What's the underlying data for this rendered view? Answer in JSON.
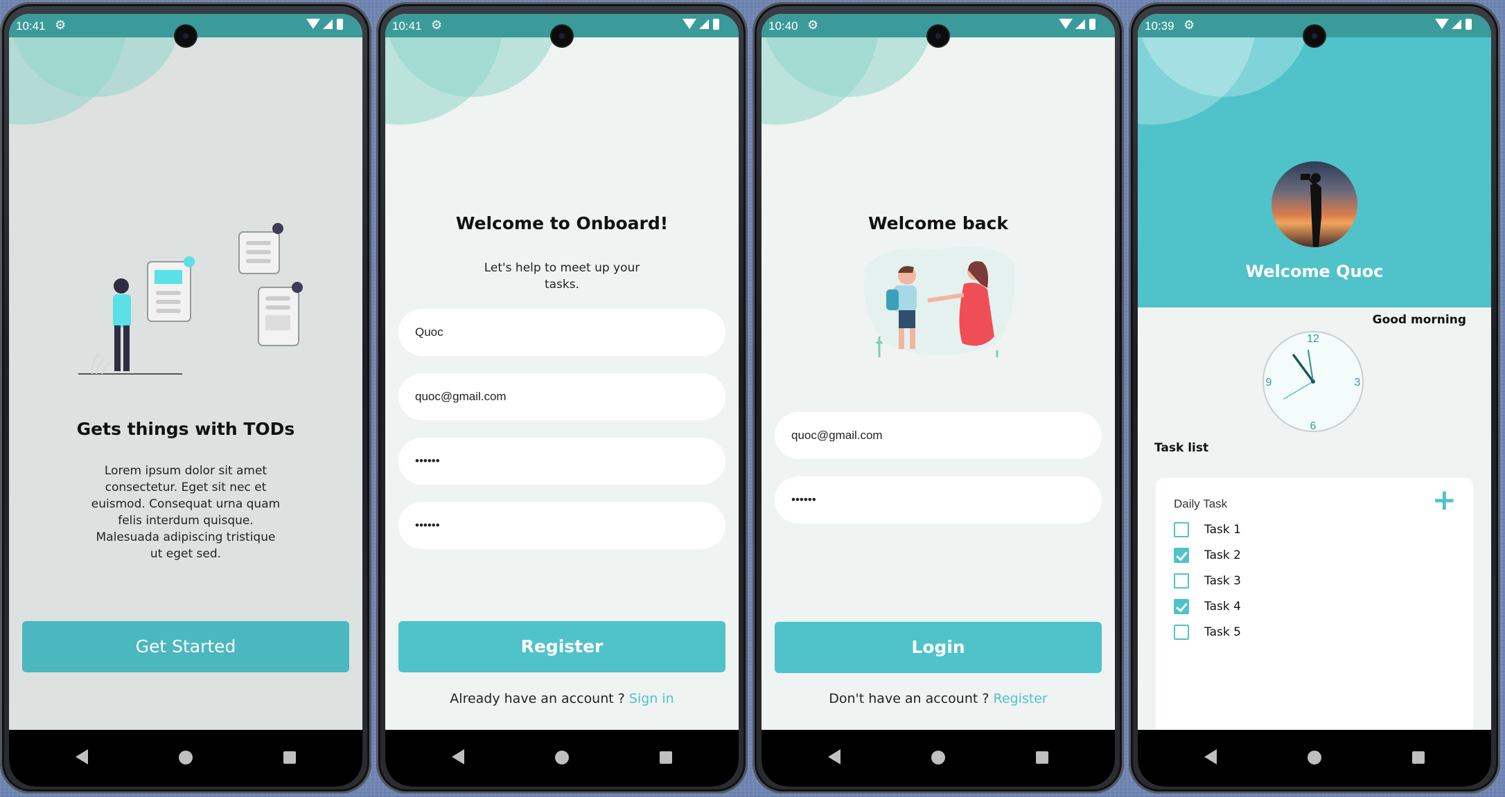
{
  "status": {
    "screen1_time": "10:41",
    "screen2_time": "10:41",
    "screen3_time": "10:40",
    "screen4_time": "10:39"
  },
  "screen1": {
    "title": "Gets things with TODs",
    "body": "Lorem ipsum dolor sit amet consectetur. Eget sit nec et euismod. Consequat urna quam felis interdum quisque. Malesuada adipiscing tristique ut eget sed.",
    "button": "Get Started"
  },
  "screen2": {
    "title": "Welcome to Onboard!",
    "subtitle": "Let's help to meet up your tasks.",
    "name_value": "Quoc",
    "email_value": "quoc@gmail.com",
    "password_value": "••••••",
    "confirm_value": "••••••",
    "button": "Register",
    "footer_text": "Already have an account ? ",
    "footer_link": "Sign in"
  },
  "screen3": {
    "title": "Welcome back",
    "email_value": "quoc@gmail.com",
    "password_value": "••••••",
    "button": "Login",
    "footer_text": "Don't have an account ? ",
    "footer_link": "Register"
  },
  "screen4": {
    "welcome": "Welcome Quoc",
    "greeting": "Good morning",
    "clock_numbers": [
      "12",
      "3",
      "6",
      "9"
    ],
    "section_title": "Task list",
    "card_title": "Daily Task",
    "add_symbol": "+",
    "tasks": [
      {
        "label": "Task 1",
        "checked": false
      },
      {
        "label": "Task 2",
        "checked": true
      },
      {
        "label": "Task 3",
        "checked": false
      },
      {
        "label": "Task 4",
        "checked": true
      },
      {
        "label": "Task 5",
        "checked": false
      }
    ]
  },
  "colors": {
    "accent": "#50c2c9",
    "statusbar": "#3a9b9a",
    "background": "#eff3f2"
  }
}
